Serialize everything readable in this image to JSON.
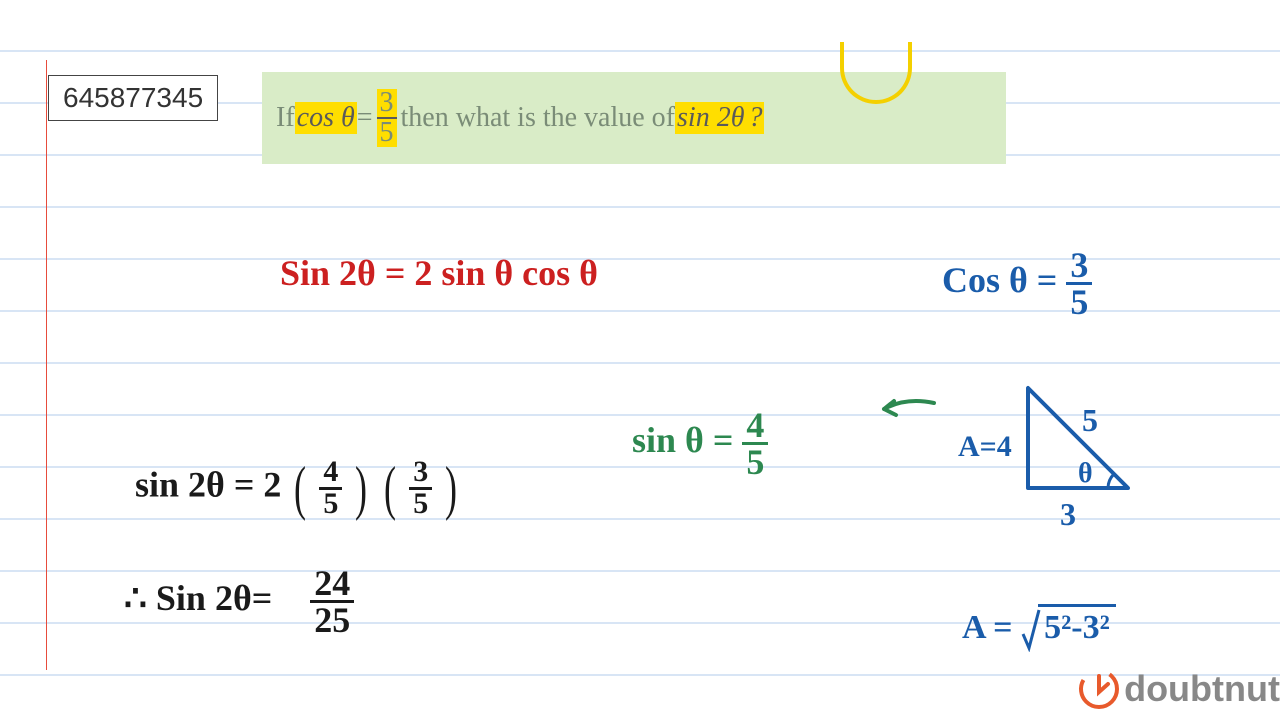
{
  "id_box": "645877345",
  "question": {
    "prefix": "If ",
    "cos": "cos θ",
    "equals": " = ",
    "frac_num": "3",
    "frac_den": "5",
    "middle": " then what is the value of ",
    "sin2t": "sin 2θ",
    "suffix": "?"
  },
  "formula_red": "Sin 2θ  =  2 sin θ cos θ",
  "cos_blue": {
    "lhs": "Cos θ = ",
    "num": "3",
    "den": "5"
  },
  "sin_green": {
    "lhs": "sin θ = ",
    "num": "4",
    "den": "5"
  },
  "calc1": {
    "lhs": "sin 2θ = 2 ",
    "f1n": "4",
    "f1d": "5",
    "f2n": "3",
    "f2d": "5"
  },
  "calc2": {
    "prefix": "∴ Sin 2θ= ",
    "num": "24",
    "den": "25"
  },
  "triangle": {
    "a_label": "A=4",
    "hyp": "5",
    "base": "3",
    "angle": "θ"
  },
  "pythag": {
    "lhs": "A = ",
    "inside": "5²-3²"
  },
  "logo_text": "doubtnut"
}
